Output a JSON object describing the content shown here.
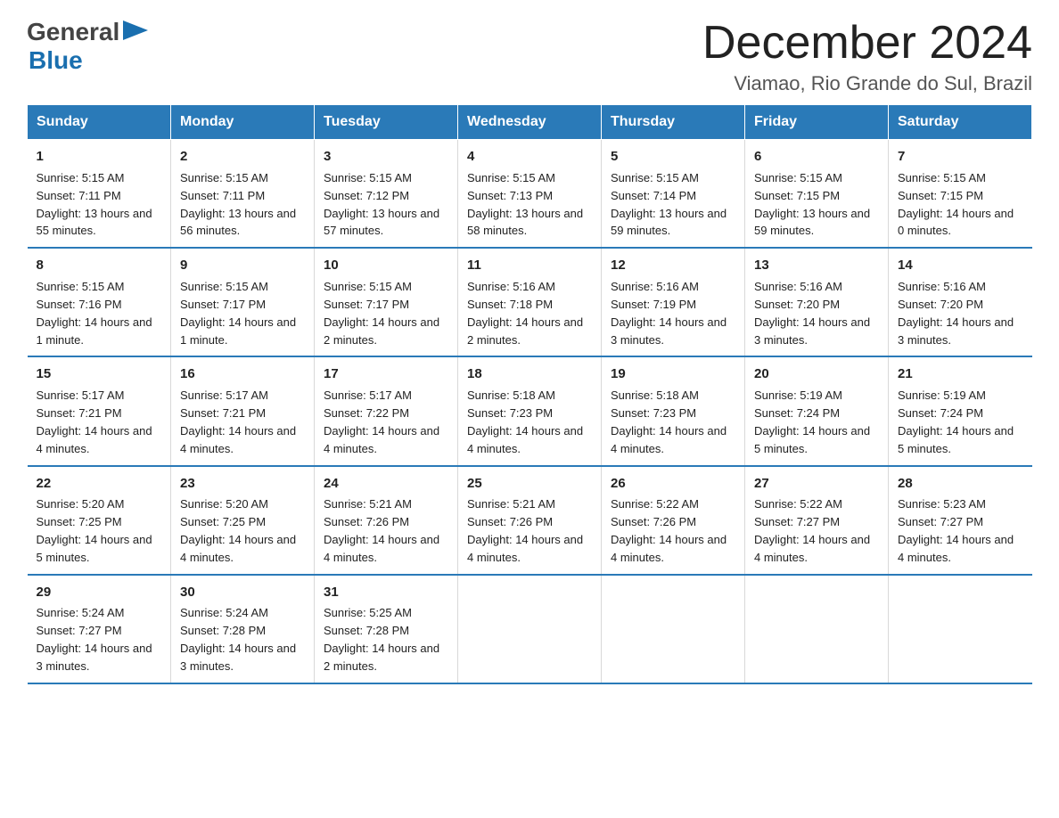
{
  "logo": {
    "general": "General",
    "blue": "Blue"
  },
  "title": "December 2024",
  "location": "Viamao, Rio Grande do Sul, Brazil",
  "days_of_week": [
    "Sunday",
    "Monday",
    "Tuesday",
    "Wednesday",
    "Thursday",
    "Friday",
    "Saturday"
  ],
  "weeks": [
    [
      {
        "day": "1",
        "sunrise": "5:15 AM",
        "sunset": "7:11 PM",
        "daylight": "13 hours and 55 minutes."
      },
      {
        "day": "2",
        "sunrise": "5:15 AM",
        "sunset": "7:11 PM",
        "daylight": "13 hours and 56 minutes."
      },
      {
        "day": "3",
        "sunrise": "5:15 AM",
        "sunset": "7:12 PM",
        "daylight": "13 hours and 57 minutes."
      },
      {
        "day": "4",
        "sunrise": "5:15 AM",
        "sunset": "7:13 PM",
        "daylight": "13 hours and 58 minutes."
      },
      {
        "day": "5",
        "sunrise": "5:15 AM",
        "sunset": "7:14 PM",
        "daylight": "13 hours and 59 minutes."
      },
      {
        "day": "6",
        "sunrise": "5:15 AM",
        "sunset": "7:15 PM",
        "daylight": "13 hours and 59 minutes."
      },
      {
        "day": "7",
        "sunrise": "5:15 AM",
        "sunset": "7:15 PM",
        "daylight": "14 hours and 0 minutes."
      }
    ],
    [
      {
        "day": "8",
        "sunrise": "5:15 AM",
        "sunset": "7:16 PM",
        "daylight": "14 hours and 1 minute."
      },
      {
        "day": "9",
        "sunrise": "5:15 AM",
        "sunset": "7:17 PM",
        "daylight": "14 hours and 1 minute."
      },
      {
        "day": "10",
        "sunrise": "5:15 AM",
        "sunset": "7:17 PM",
        "daylight": "14 hours and 2 minutes."
      },
      {
        "day": "11",
        "sunrise": "5:16 AM",
        "sunset": "7:18 PM",
        "daylight": "14 hours and 2 minutes."
      },
      {
        "day": "12",
        "sunrise": "5:16 AM",
        "sunset": "7:19 PM",
        "daylight": "14 hours and 3 minutes."
      },
      {
        "day": "13",
        "sunrise": "5:16 AM",
        "sunset": "7:20 PM",
        "daylight": "14 hours and 3 minutes."
      },
      {
        "day": "14",
        "sunrise": "5:16 AM",
        "sunset": "7:20 PM",
        "daylight": "14 hours and 3 minutes."
      }
    ],
    [
      {
        "day": "15",
        "sunrise": "5:17 AM",
        "sunset": "7:21 PM",
        "daylight": "14 hours and 4 minutes."
      },
      {
        "day": "16",
        "sunrise": "5:17 AM",
        "sunset": "7:21 PM",
        "daylight": "14 hours and 4 minutes."
      },
      {
        "day": "17",
        "sunrise": "5:17 AM",
        "sunset": "7:22 PM",
        "daylight": "14 hours and 4 minutes."
      },
      {
        "day": "18",
        "sunrise": "5:18 AM",
        "sunset": "7:23 PM",
        "daylight": "14 hours and 4 minutes."
      },
      {
        "day": "19",
        "sunrise": "5:18 AM",
        "sunset": "7:23 PM",
        "daylight": "14 hours and 4 minutes."
      },
      {
        "day": "20",
        "sunrise": "5:19 AM",
        "sunset": "7:24 PM",
        "daylight": "14 hours and 5 minutes."
      },
      {
        "day": "21",
        "sunrise": "5:19 AM",
        "sunset": "7:24 PM",
        "daylight": "14 hours and 5 minutes."
      }
    ],
    [
      {
        "day": "22",
        "sunrise": "5:20 AM",
        "sunset": "7:25 PM",
        "daylight": "14 hours and 5 minutes."
      },
      {
        "day": "23",
        "sunrise": "5:20 AM",
        "sunset": "7:25 PM",
        "daylight": "14 hours and 4 minutes."
      },
      {
        "day": "24",
        "sunrise": "5:21 AM",
        "sunset": "7:26 PM",
        "daylight": "14 hours and 4 minutes."
      },
      {
        "day": "25",
        "sunrise": "5:21 AM",
        "sunset": "7:26 PM",
        "daylight": "14 hours and 4 minutes."
      },
      {
        "day": "26",
        "sunrise": "5:22 AM",
        "sunset": "7:26 PM",
        "daylight": "14 hours and 4 minutes."
      },
      {
        "day": "27",
        "sunrise": "5:22 AM",
        "sunset": "7:27 PM",
        "daylight": "14 hours and 4 minutes."
      },
      {
        "day": "28",
        "sunrise": "5:23 AM",
        "sunset": "7:27 PM",
        "daylight": "14 hours and 4 minutes."
      }
    ],
    [
      {
        "day": "29",
        "sunrise": "5:24 AM",
        "sunset": "7:27 PM",
        "daylight": "14 hours and 3 minutes."
      },
      {
        "day": "30",
        "sunrise": "5:24 AM",
        "sunset": "7:28 PM",
        "daylight": "14 hours and 3 minutes."
      },
      {
        "day": "31",
        "sunrise": "5:25 AM",
        "sunset": "7:28 PM",
        "daylight": "14 hours and 2 minutes."
      },
      null,
      null,
      null,
      null
    ]
  ],
  "labels": {
    "sunrise": "Sunrise:",
    "sunset": "Sunset:",
    "daylight": "Daylight:"
  }
}
